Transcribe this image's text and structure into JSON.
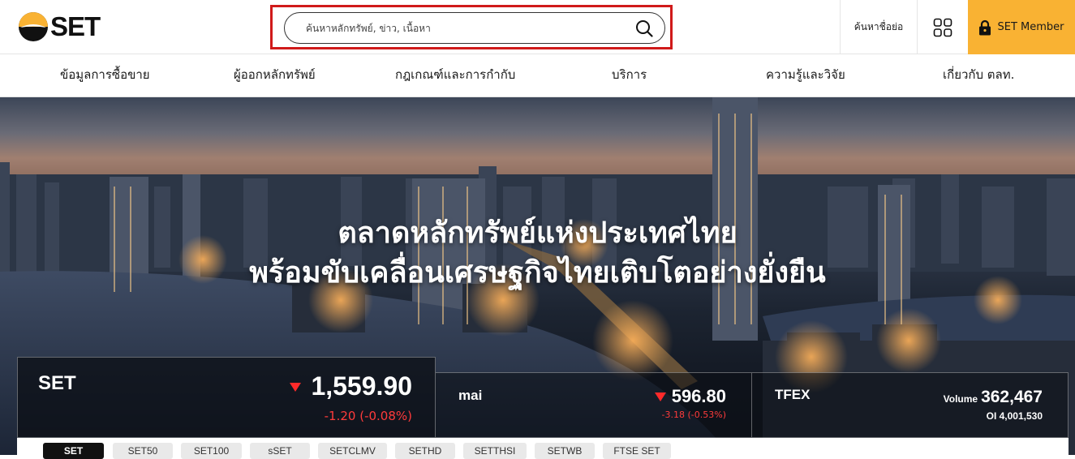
{
  "header": {
    "logo_text": "SET",
    "search": {
      "placeholder": "ค้นหาหลักทรัพย์, ข่าว, เนื้อหา",
      "value": ""
    },
    "quick_search_label": "ค้นหาชื่อย่อ",
    "member_label": "SET Member"
  },
  "nav": {
    "items": [
      {
        "label": "ข้อมูลการซื้อขาย"
      },
      {
        "label": "ผู้ออกหลักทรัพย์"
      },
      {
        "label": "กฎเกณฑ์และการกำกับ"
      },
      {
        "label": "บริการ"
      },
      {
        "label": "ความรู้และวิจัย"
      },
      {
        "label": "เกี่ยวกับ ตลท."
      }
    ]
  },
  "hero": {
    "title_line1": "ตลาดหลักทรัพย์แห่งประเทศไทย",
    "title_line2": "พร้อมขับเคลื่อนเศรษฐกิจไทยเติบโตอย่างยั่งยืน"
  },
  "indices": {
    "set": {
      "name": "SET",
      "value": "1,559.90",
      "change": "-1.20 (-0.08%)",
      "direction": "down"
    },
    "mai": {
      "name": "mai",
      "value": "596.80",
      "change": "-3.18 (-0.53%)",
      "direction": "down"
    },
    "tfex": {
      "name": "TFEX",
      "volume_label": "Volume",
      "volume": "362,467",
      "oi": "OI 4,001,530"
    }
  },
  "tabs": [
    {
      "label": "SET",
      "active": true
    },
    {
      "label": "SET50",
      "active": false
    },
    {
      "label": "SET100",
      "active": false
    },
    {
      "label": "sSET",
      "active": false
    },
    {
      "label": "SETCLMV",
      "active": false
    },
    {
      "label": "SETHD",
      "active": false
    },
    {
      "label": "SETTHSI",
      "active": false
    },
    {
      "label": "SETWB",
      "active": false
    },
    {
      "label": "FTSE SET",
      "active": false
    }
  ],
  "colors": {
    "accent": "#f9b233",
    "highlight_border": "#d01a1a",
    "negative": "#ff3b3b"
  }
}
